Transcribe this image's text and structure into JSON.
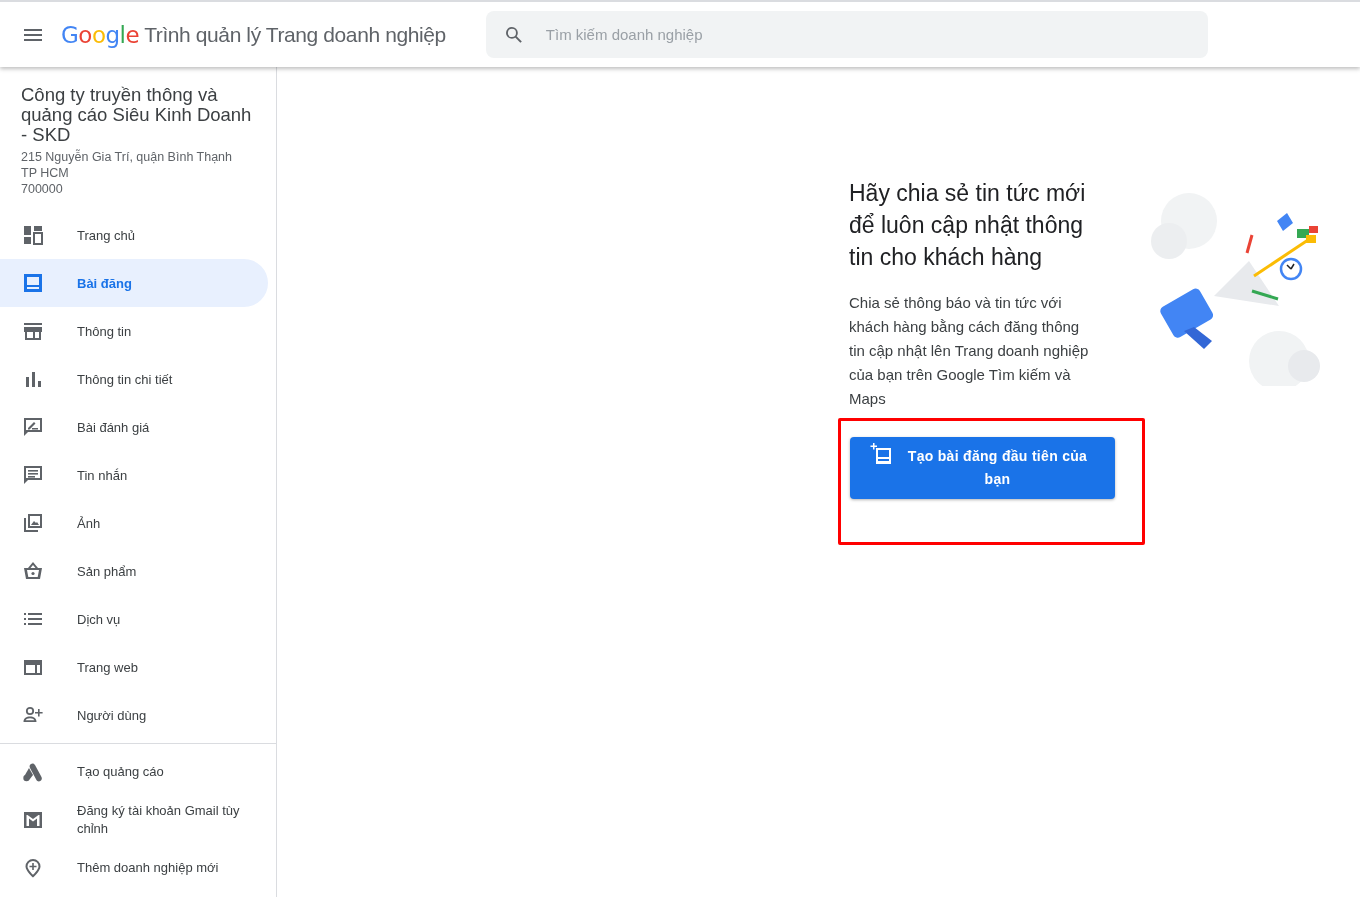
{
  "header": {
    "logo": "Google",
    "title": "Trình quản lý Trang doanh nghiệp",
    "search": {
      "placeholder": "Tìm kiếm doanh nghiệp"
    }
  },
  "business": {
    "name": "Công ty truyền thông và quảng cáo Siêu Kinh Doanh - SKD",
    "address_lines": [
      "215 Nguyễn Gia Trí, quận Bình Thạnh",
      "TP HCM",
      "700000"
    ]
  },
  "sidebar": {
    "items": [
      {
        "label": "Trang chủ",
        "selected": false
      },
      {
        "label": "Bài đăng",
        "selected": true
      },
      {
        "label": "Thông tin",
        "selected": false
      },
      {
        "label": "Thông tin chi tiết",
        "selected": false
      },
      {
        "label": "Bài đánh giá",
        "selected": false
      },
      {
        "label": "Tin nhắn",
        "selected": false
      },
      {
        "label": "Ảnh",
        "selected": false
      },
      {
        "label": "Sản phẩm",
        "selected": false
      },
      {
        "label": "Dịch vụ",
        "selected": false
      },
      {
        "label": "Trang web",
        "selected": false
      },
      {
        "label": "Người dùng",
        "selected": false
      }
    ],
    "extra_items": [
      {
        "label": "Tạo quảng cáo"
      },
      {
        "label": "Đăng ký tài khoản Gmail tùy chỉnh"
      },
      {
        "label": "Thêm doanh nghiệp mới"
      }
    ]
  },
  "promo": {
    "heading": "Hãy chia sẻ tin tức mới để luôn cập nhật thông tin cho khách hàng",
    "body": "Chia sẻ thông báo và tin tức với khách hàng bằng cách đăng thông tin cập nhật lên Trang doanh nghiệp của bạn trên Google Tìm kiếm và Maps",
    "button": "Tạo bài đăng đầu tiên của bạn",
    "highlighted": true
  }
}
